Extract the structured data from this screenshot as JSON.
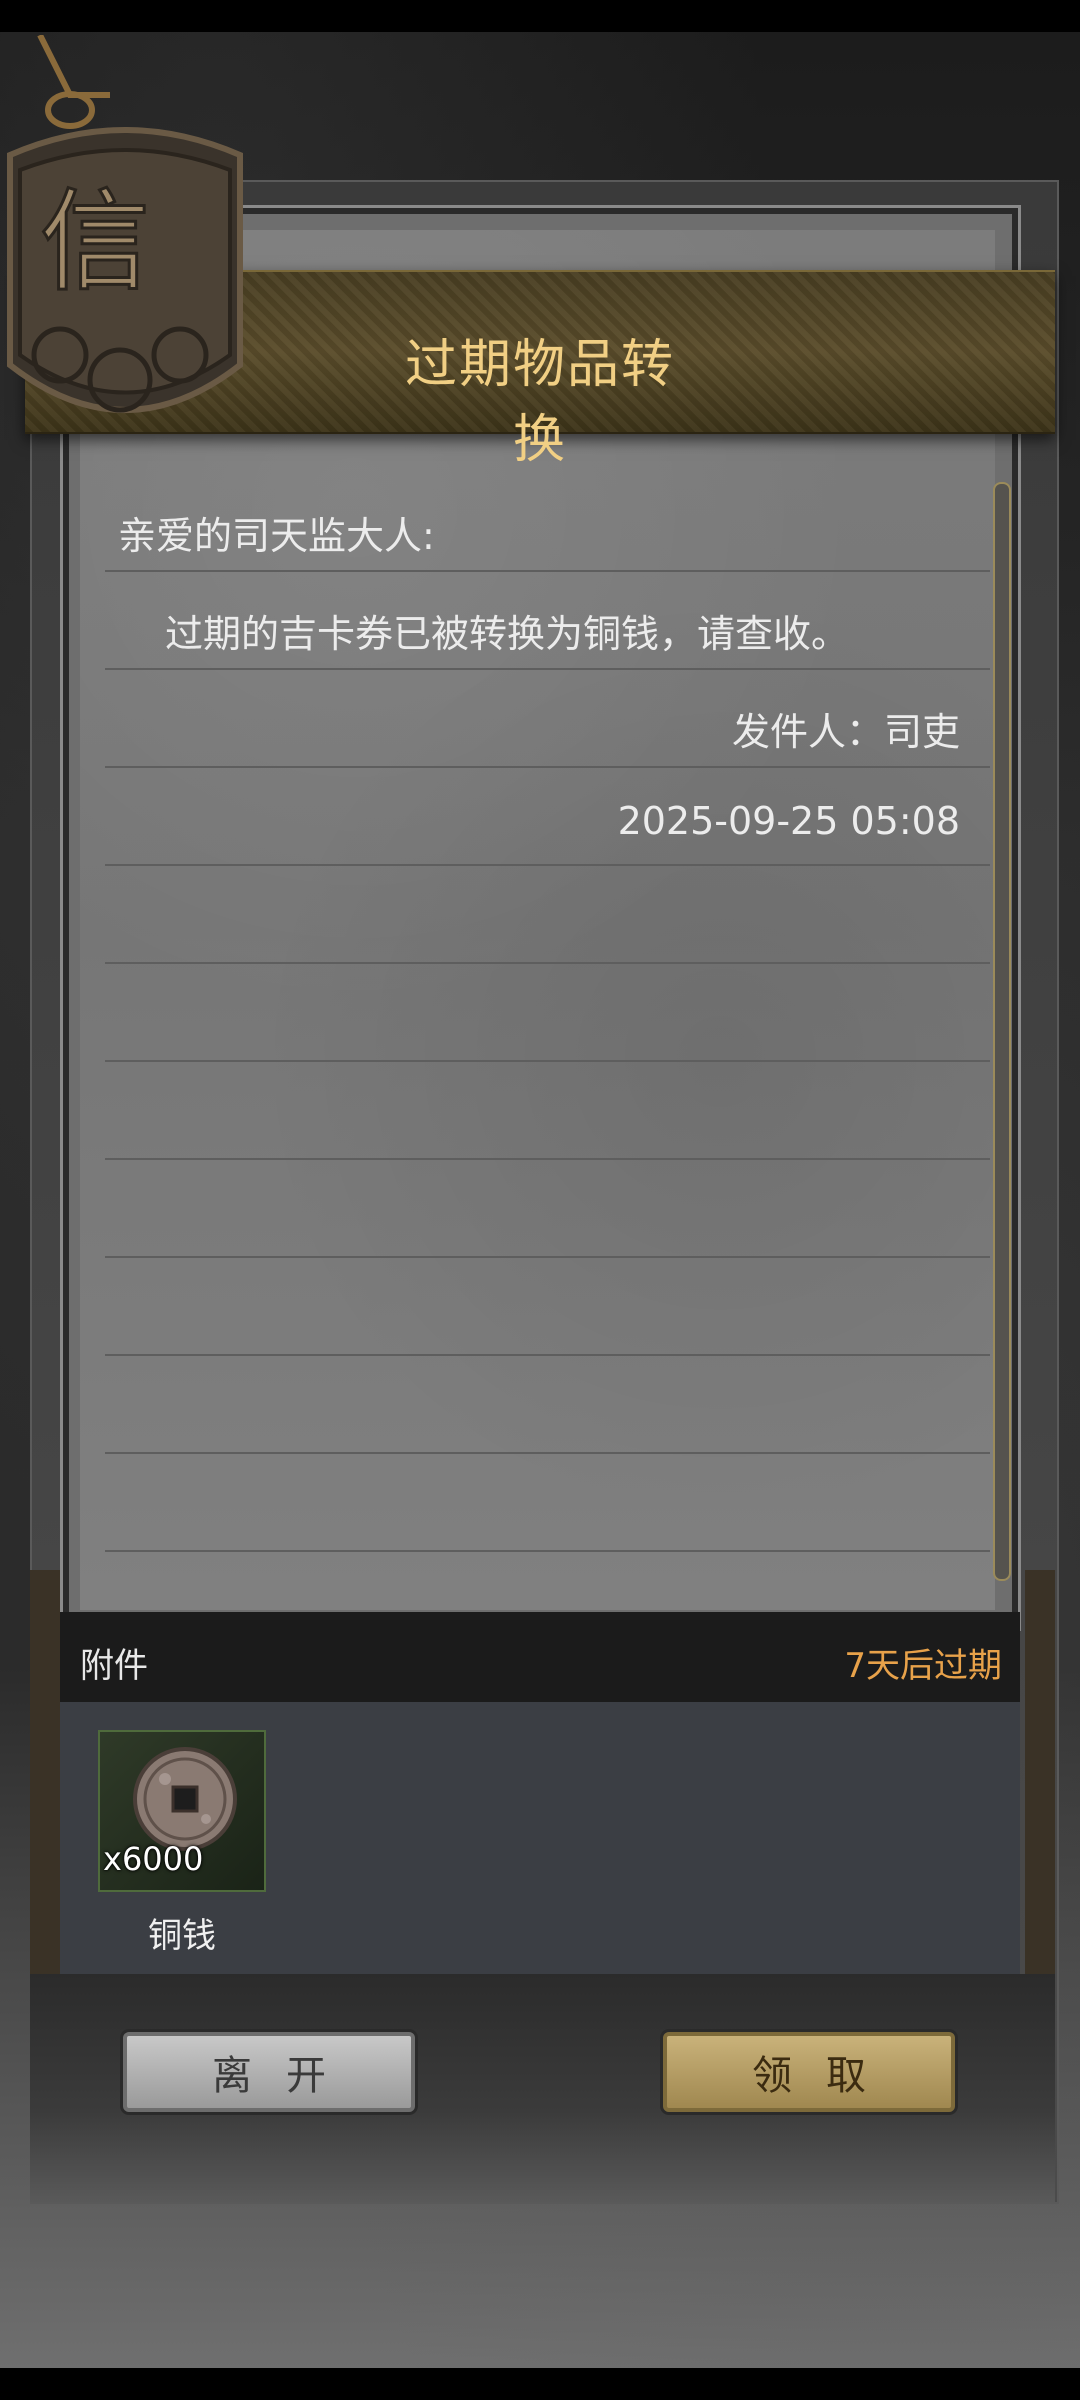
{
  "mail": {
    "title": "过期物品转换",
    "greeting": "亲爱的司天监大人:",
    "body": "过期的吉卡券已被转换为铜钱，请查收。",
    "sender": "发件人：司吏",
    "datetime": "2025-09-25 05:08",
    "seal_char": "信"
  },
  "attachment": {
    "label": "附件",
    "expire": "7天后过期",
    "items": [
      {
        "name": "铜钱",
        "count": "x6000",
        "icon": "copper-coin-icon"
      }
    ]
  },
  "buttons": {
    "leave": "离开",
    "claim": "领取"
  },
  "colors": {
    "title": "#f1cf84",
    "expire": "#e8a24a",
    "claim_button": "#c9b27a",
    "leave_button": "#c8c8c8"
  }
}
